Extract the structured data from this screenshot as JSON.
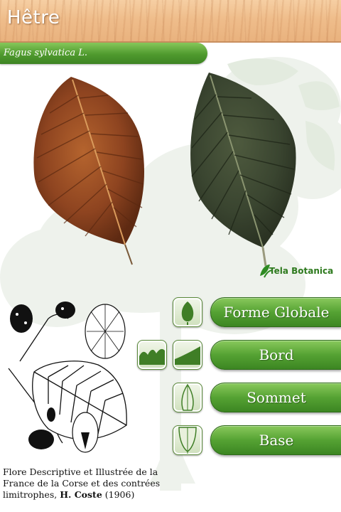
{
  "header": {
    "title": "Hêtre"
  },
  "species": {
    "name": "Fagus sylvatica L."
  },
  "logo": {
    "text": "Tela Botanica"
  },
  "menu": {
    "items": [
      {
        "label": "Forme Globale",
        "icon": "leaf-shape-icon"
      },
      {
        "label": "Bord",
        "icons": [
          "leaf-edge-wavy-icon",
          "leaf-edge-smooth-icon"
        ]
      },
      {
        "label": "Sommet",
        "icon": "leaf-tip-icon"
      },
      {
        "label": "Base",
        "icon": "leaf-base-icon"
      }
    ]
  },
  "caption": {
    "text": "Flore Descriptive et Illustrée de la France de la Corse et des contrées limitrophes,",
    "author": "H. Coste",
    "year": "(1906)"
  },
  "colors": {
    "accent_green": "#4f9a2e",
    "header_wood": "#efbd8b"
  }
}
